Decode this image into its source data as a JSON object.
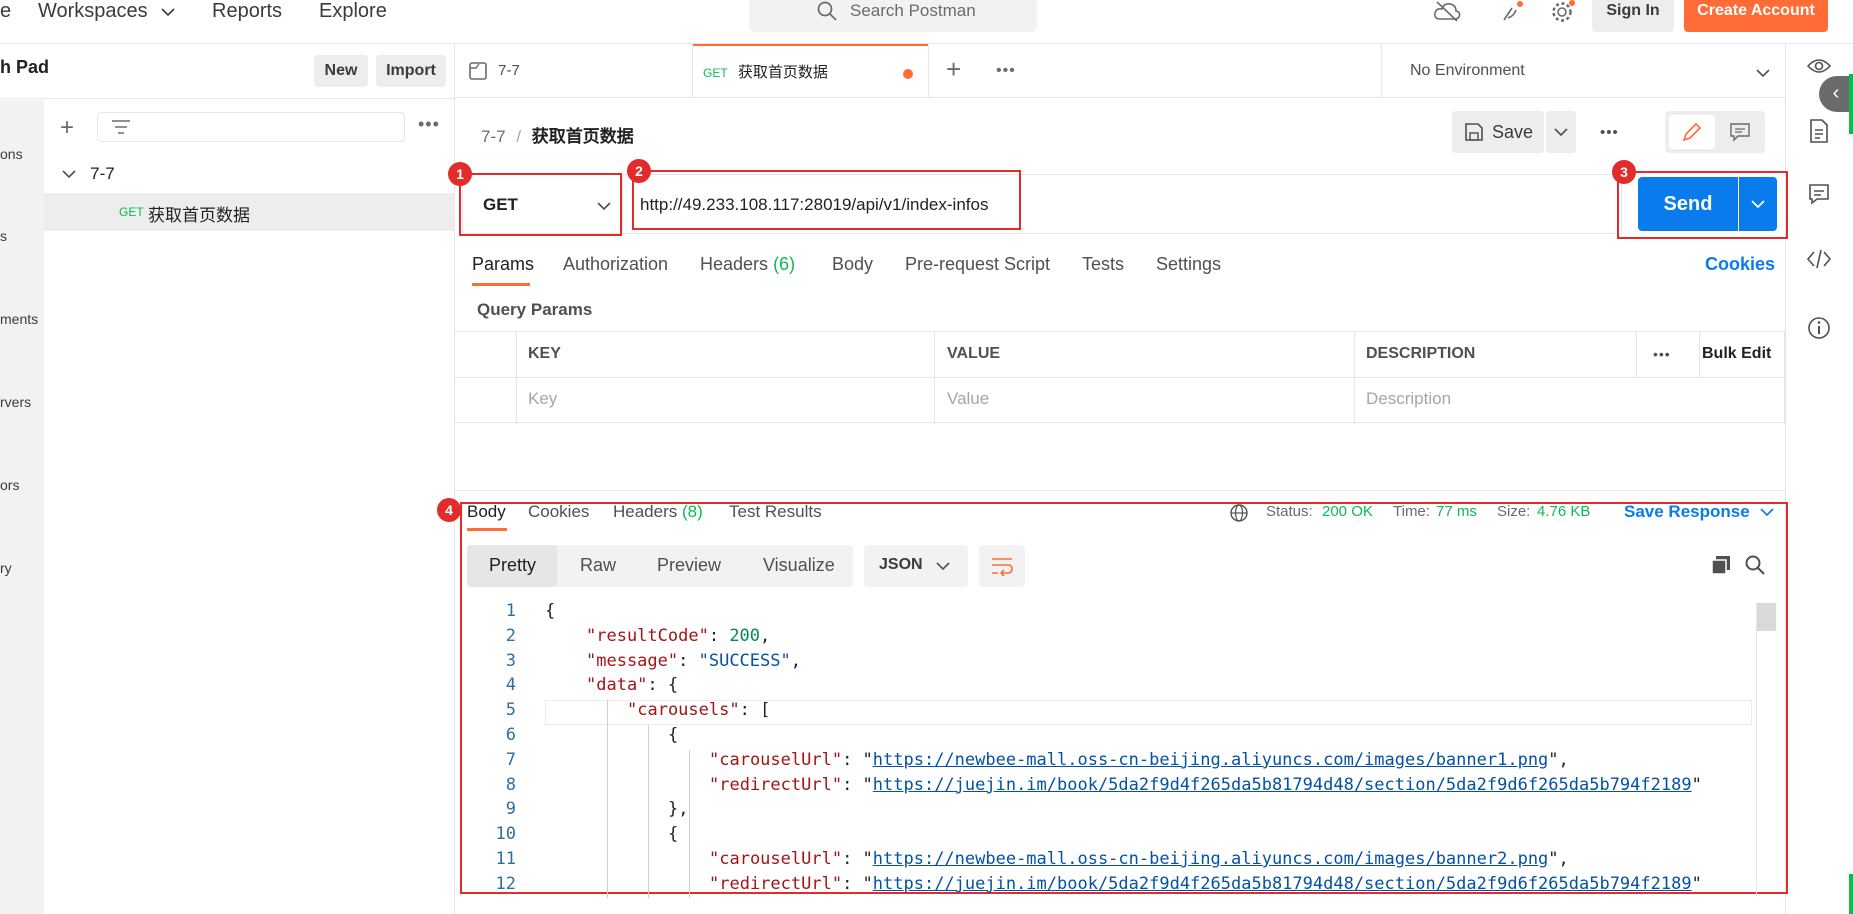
{
  "topbar": {
    "truncated_item": "e",
    "workspaces": "Workspaces",
    "reports": "Reports",
    "explore": "Explore",
    "search_placeholder": "Search Postman",
    "sign_in": "Sign In",
    "create_account": "Create Account"
  },
  "sidebar": {
    "title": "h Pad",
    "new_label": "New",
    "import_label": "Import",
    "rail_labels": [
      "ons",
      "s",
      "ments",
      "rvers",
      "ors",
      "ry"
    ],
    "collection_name": "7-7",
    "request_method": "GET",
    "request_name": "获取首页数据"
  },
  "tabs": {
    "tab1_label": "7-7",
    "tab2_method": "GET",
    "tab2_label": "获取首页数据",
    "environment": "No Environment"
  },
  "request": {
    "breadcrumb_parent": "7-7",
    "breadcrumb_sep": "/",
    "breadcrumb_current": "获取首页数据",
    "save_label": "Save",
    "method": "GET",
    "url": "http://49.233.108.117:28019/api/v1/index-infos",
    "send_label": "Send",
    "badges": [
      "1",
      "2",
      "3",
      "4"
    ],
    "tabs": {
      "params": "Params",
      "authorization": "Authorization",
      "headers": "Headers",
      "headers_count": "(6)",
      "body": "Body",
      "prerequest": "Pre-request Script",
      "tests": "Tests",
      "settings": "Settings",
      "cookies": "Cookies"
    },
    "query_params_title": "Query Params",
    "table": {
      "col_key": "KEY",
      "col_value": "VALUE",
      "col_description": "DESCRIPTION",
      "bulk_edit": "Bulk Edit",
      "ph_key": "Key",
      "ph_value": "Value",
      "ph_description": "Description"
    }
  },
  "response": {
    "tabs": {
      "body": "Body",
      "cookies": "Cookies",
      "headers": "Headers",
      "headers_count": "(8)",
      "test_results": "Test Results"
    },
    "status_label": "Status:",
    "status_value": "200 OK",
    "time_label": "Time:",
    "time_value": "77 ms",
    "size_label": "Size:",
    "size_value": "4.76 KB",
    "save_response": "Save Response",
    "formats": [
      "Pretty",
      "Raw",
      "Preview",
      "Visualize"
    ],
    "language": "JSON",
    "lines": [
      {
        "n": "1",
        "text": "{"
      },
      {
        "n": "2",
        "key": "\"resultCode\"",
        "rest": ": ",
        "num": "200",
        "tail": ","
      },
      {
        "n": "3",
        "key": "\"message\"",
        "rest": ": ",
        "str": "\"SUCCESS\"",
        "tail": ","
      },
      {
        "n": "4",
        "key": "\"data\"",
        "rest": ": {"
      },
      {
        "n": "5",
        "key": "\"carousels\"",
        "rest": ": ["
      },
      {
        "n": "6",
        "text": "{"
      },
      {
        "n": "7",
        "key": "\"carouselUrl\"",
        "rest": ": \"",
        "url": "https://newbee-mall.oss-cn-beijing.aliyuncs.com/images/banner1.png",
        "tail": "\","
      },
      {
        "n": "8",
        "key": "\"redirectUrl\"",
        "rest": ": \"",
        "url": "https://juejin.im/book/5da2f9d4f265da5b81794d48/section/5da2f9d6f265da5b794f2189",
        "tail": "\""
      },
      {
        "n": "9",
        "text": "},"
      },
      {
        "n": "10",
        "text": "{"
      },
      {
        "n": "11",
        "key": "\"carouselUrl\"",
        "rest": ": \"",
        "url": "https://newbee-mall.oss-cn-beijing.aliyuncs.com/images/banner2.png",
        "tail": "\","
      },
      {
        "n": "12",
        "key": "\"redirectUrl\"",
        "rest": ": \"",
        "url": "https://juejin.im/book/5da2f9d4f265da5b81794d48/section/5da2f9d6f265da5b794f2189",
        "tail": "\""
      }
    ]
  },
  "colors": {
    "accent_orange": "#ff6c37",
    "send_blue": "#097bed",
    "status_green": "#0cbb52",
    "highlight_red": "#e32b2b"
  }
}
